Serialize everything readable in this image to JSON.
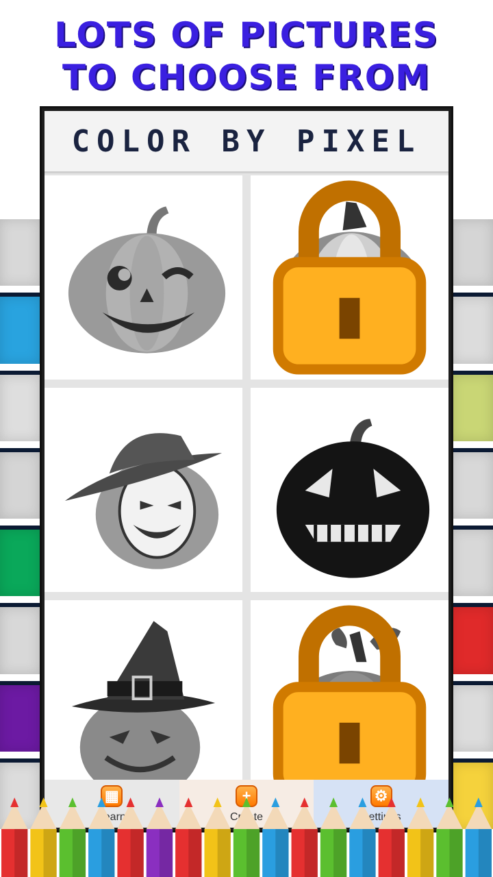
{
  "headline": {
    "line1": "LOTS OF PICTURES",
    "line2": "TO CHOOSE FROM"
  },
  "app": {
    "title": "COLOR BY PIXEL"
  },
  "gallery": {
    "items": [
      {
        "name": "winking-pumpkin",
        "locked": false
      },
      {
        "name": "grinning-pumpkin",
        "locked": true
      },
      {
        "name": "pumpkin-with-hat",
        "locked": false
      },
      {
        "name": "angry-black-pumpkin",
        "locked": false
      },
      {
        "name": "pumpkin-with-witch-hat",
        "locked": false
      },
      {
        "name": "pumpkin-with-leaves",
        "locked": true
      }
    ]
  },
  "tabs": [
    {
      "label": "Learn",
      "icon": "grid-icon"
    },
    {
      "label": "Create",
      "icon": "plus-icon"
    },
    {
      "label": "Settings",
      "icon": "gear-icon"
    }
  ],
  "colors": {
    "headline": "#3a1fe0",
    "left_strips": [
      "#d8d8d8",
      "#29a3df",
      "#dedede",
      "#d5d5d5",
      "#0aa85a",
      "#d8d8d8",
      "#6c1aa3",
      "#dcdcdc"
    ],
    "right_strips": [
      "#d5d5d5",
      "#dcdcdc",
      "#c9d675",
      "#d8d8d8",
      "#d8d8d8",
      "#e02a2a",
      "#dcdcdc",
      "#f5d23c"
    ],
    "pencils": [
      "#e53030",
      "#f2c318",
      "#5bbf2f",
      "#2a9ee0",
      "#e53030",
      "#8a2fc0",
      "#e53030",
      "#f2c318",
      "#5bbf2f",
      "#2a9ee0",
      "#e53030",
      "#5bbf2f",
      "#2a9ee0",
      "#e53030",
      "#f2c318",
      "#5bbf2f",
      "#2a9ee0"
    ]
  }
}
